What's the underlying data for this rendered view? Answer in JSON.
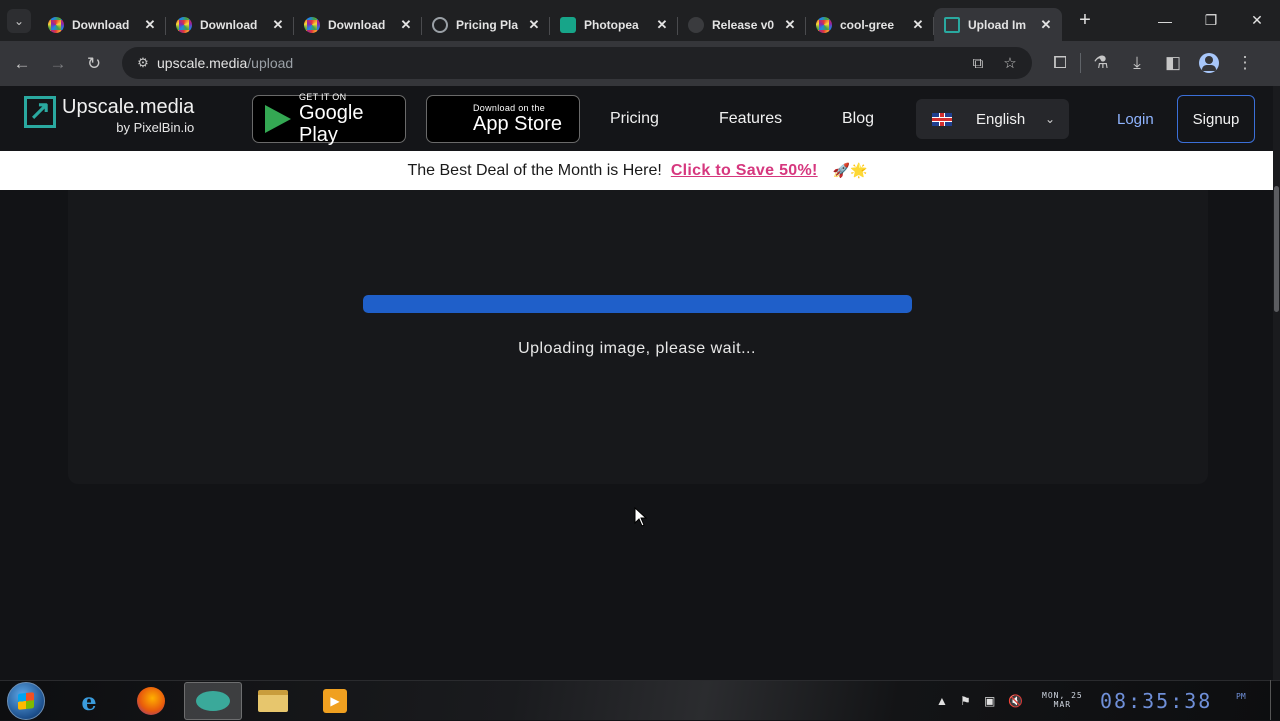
{
  "browser": {
    "tabs": [
      {
        "title": "Download",
        "favicon": "color-ring-icon",
        "active": false
      },
      {
        "title": "Download",
        "favicon": "color-ring-icon",
        "active": false
      },
      {
        "title": "Download",
        "favicon": "color-ring-icon",
        "active": false
      },
      {
        "title": "Pricing Pla",
        "favicon": "globe-icon",
        "active": false
      },
      {
        "title": "Photopea",
        "favicon": "photopea-icon",
        "active": false
      },
      {
        "title": "Release v0",
        "favicon": "github-icon",
        "active": false
      },
      {
        "title": "cool-gree",
        "favicon": "color-ring-icon",
        "active": false
      },
      {
        "title": "Upload Im",
        "favicon": "upscale-icon",
        "active": true
      }
    ],
    "address": {
      "host": "upscale.media",
      "path": "/upload"
    }
  },
  "site": {
    "logo_name": "Upscale.media",
    "logo_by": "by PixelBin.io",
    "google_play": {
      "small": "GET IT ON",
      "big": "Google Play"
    },
    "app_store": {
      "small": "Download on the",
      "big": "App Store"
    },
    "nav": {
      "pricing": "Pricing",
      "features": "Features",
      "blog": "Blog"
    },
    "language": "English",
    "login": "Login",
    "signup": "Signup"
  },
  "promo": {
    "text": "The Best Deal of the Month is Here!",
    "cta": "Click to Save 50%!",
    "emoji": "🚀🌟"
  },
  "upload": {
    "status": "Uploading image, please wait...",
    "progress_percent": 100,
    "bar_color": "#1f5fc9"
  },
  "taskbar": {
    "clock_date_line1": "MON, 25",
    "clock_date_line2": "MAR",
    "clock_time": "08:35:38",
    "clock_ampm": "PM"
  },
  "colors": {
    "accent_teal": "#2aa9a0",
    "cta_pink": "#d6377e",
    "signup_border": "#3b6fd8"
  }
}
